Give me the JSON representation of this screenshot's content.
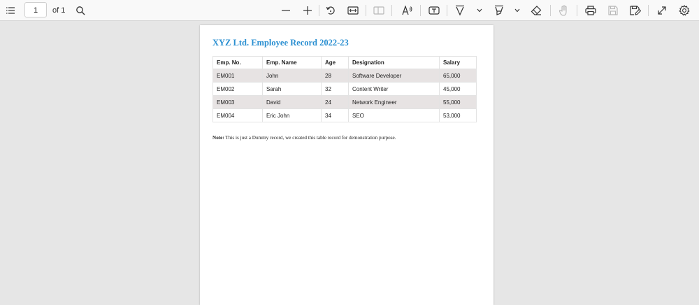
{
  "toolbar": {
    "page_number": "1",
    "page_total": "of 1",
    "icons": [
      "toc-icon",
      "search-icon",
      "zoom-out-icon",
      "zoom-in-icon",
      "rotate-icon",
      "fit-width-icon",
      "page-view-icon",
      "read-aloud-icon",
      "text-box-icon",
      "draw-icon",
      "highlight-icon",
      "eraser-icon",
      "touch-icon",
      "print-icon",
      "save-icon",
      "save-as-icon",
      "fullscreen-icon",
      "settings-icon"
    ]
  },
  "document": {
    "title": "XYZ Ltd. Employee Record 2022-23",
    "table": {
      "headers": [
        "Emp. No.",
        "Emp. Name",
        "Age",
        "Designation",
        "Salary"
      ],
      "rows": [
        [
          "EM001",
          "John",
          "28",
          "Software Developer",
          "65,000"
        ],
        [
          "EM002",
          "Sarah",
          "32",
          "Content Writer",
          "45,000"
        ],
        [
          "EM003",
          "David",
          "24",
          "Network Engineer",
          "55,000"
        ],
        [
          "EM004",
          "Eric John",
          "34",
          "SEO",
          "53,000"
        ]
      ]
    },
    "note_label": "Note:",
    "note_text": " This is just a Dummy record, we created this table record for demonstration purpose."
  },
  "colors": {
    "title": "#2a8fd1",
    "shaded_row": "#e7e3e3",
    "viewer_background": "#e6e6e6"
  }
}
